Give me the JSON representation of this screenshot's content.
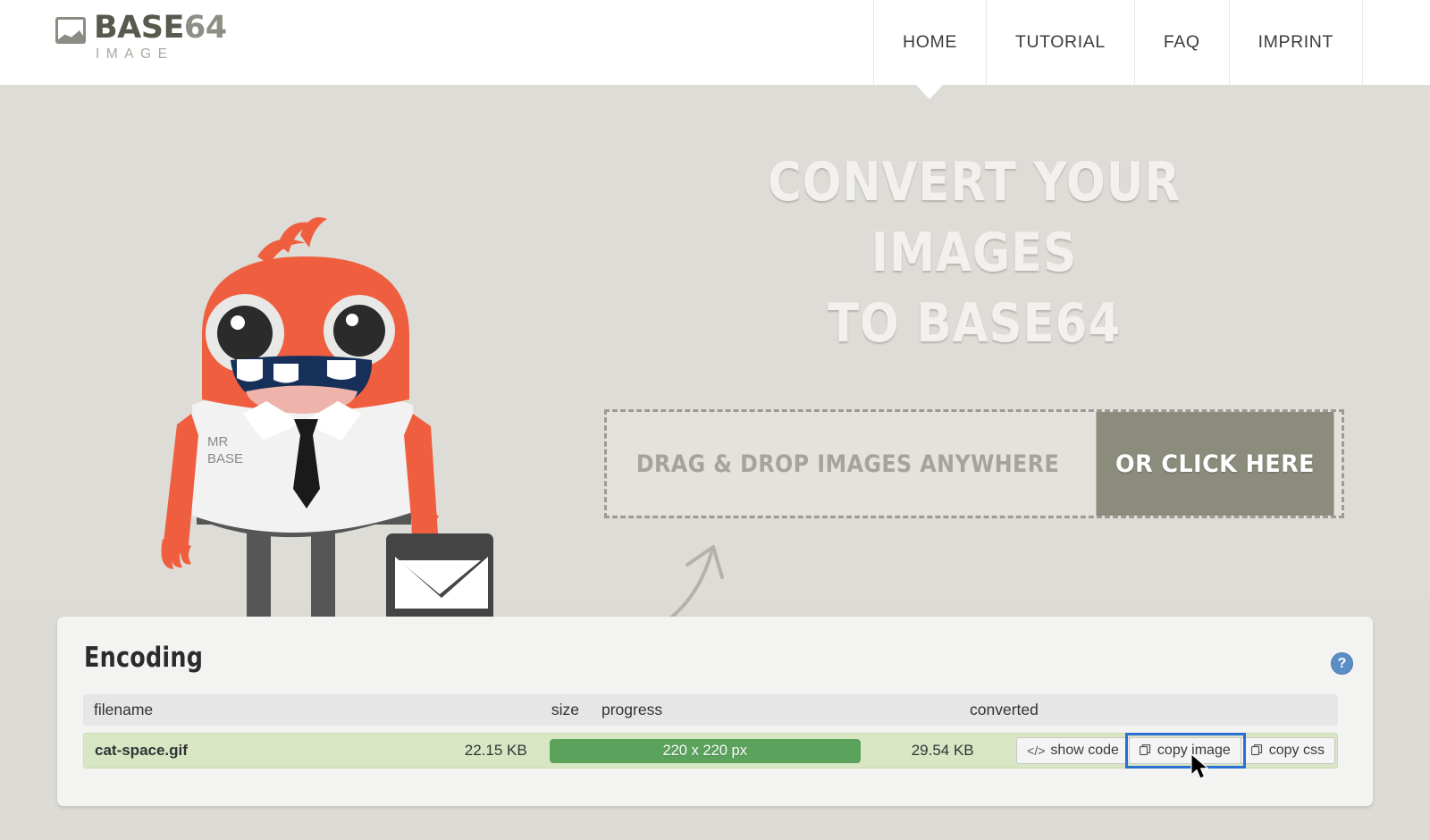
{
  "site": {
    "logo_main": "BASE",
    "logo_accent": "64",
    "logo_sub": "IMAGE",
    "logo_icon": "picture-frame-icon"
  },
  "nav": {
    "items": [
      {
        "label": "HOME",
        "active": true
      },
      {
        "label": "TUTORIAL",
        "active": false
      },
      {
        "label": "FAQ",
        "active": false
      },
      {
        "label": "IMPRINT",
        "active": false
      }
    ]
  },
  "hero": {
    "headline_line1": "CONVERT YOUR IMAGES",
    "headline_line2": "TO BASE64",
    "mascot_shirt_line1": "MR",
    "mascot_shirt_line2": "BASE",
    "mascot_name": "mr-base-mascot",
    "dropzone": {
      "label": "DRAG & DROP IMAGES ANYWHERE",
      "button": "OR CLICK HERE"
    }
  },
  "encoding": {
    "title": "Encoding",
    "help_icon": "question-mark-icon",
    "columns": [
      "filename",
      "size",
      "progress",
      "converted"
    ],
    "rows": [
      {
        "filename": "cat-space.gif",
        "size": "22.15 KB",
        "progress_label": "220 x 220 px",
        "progress_percent": 100,
        "converted": "29.54 KB",
        "actions": [
          {
            "label": "show code",
            "icon": "code-icon",
            "focused": false
          },
          {
            "label": "copy image",
            "icon": "copy-icon",
            "focused": true
          },
          {
            "label": "copy css",
            "icon": "copy-icon",
            "focused": false
          }
        ]
      }
    ]
  },
  "colors": {
    "hero_background": "#dedcd7",
    "header_background": "#ffffff",
    "mascot_body": "#ef5f3f",
    "drop_button": "#8c8c7d",
    "progress_fill": "#5ba35c",
    "row_background": "#d8e6c4",
    "focus_ring": "#2a6fd4",
    "help_icon": "#5b8ec4"
  }
}
